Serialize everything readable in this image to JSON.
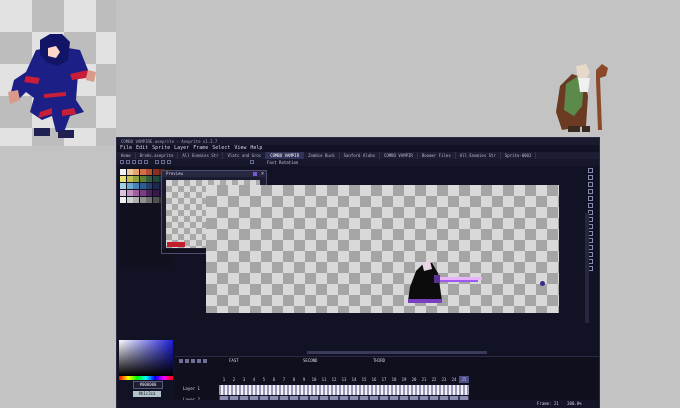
{
  "window": {
    "title": "COMBO VAMPIRE.aseprite - Aseprite v1.2.7"
  },
  "menu": [
    "File",
    "Edit",
    "Sprite",
    "Layer",
    "Frame",
    "Select",
    "View",
    "Help"
  ],
  "tabs": [
    {
      "label": "Home",
      "active": false
    },
    {
      "label": "BroAs.aseprite",
      "active": false
    },
    {
      "label": "All Enemies Str",
      "active": false
    },
    {
      "label": "Vlatc and Groc",
      "active": false
    },
    {
      "label": "COMBO VAMPIR",
      "active": true
    },
    {
      "label": "Zombie Buck",
      "active": false
    },
    {
      "label": "Sanford Alaho",
      "active": false
    },
    {
      "label": "COMBO VAMPIR",
      "active": false
    },
    {
      "label": "Boomer Files",
      "active": false
    },
    {
      "label": "All Enemies Str",
      "active": false
    },
    {
      "label": "Sprite-0002",
      "active": false
    }
  ],
  "toolbar": {
    "frame_label": "Fast Rotation"
  },
  "preview": {
    "title": "Preview"
  },
  "palette": {
    "colors": [
      "#f2f2f2",
      "#f0c8a0",
      "#e6a36b",
      "#d0704a",
      "#b84c32",
      "#8a3020",
      "#5a2618",
      "#2a1208",
      "#e8e070",
      "#c0c050",
      "#90a040",
      "#608030",
      "#306040",
      "#204838",
      "#183048",
      "#102838",
      "#a0d0e8",
      "#70a8d0",
      "#4a80b8",
      "#2f5c90",
      "#243e6e",
      "#1c2850",
      "#181838",
      "#101020",
      "#e0c0e0",
      "#c090c0",
      "#a060a0",
      "#784080",
      "#502060",
      "#381848",
      "#201030",
      "#000000",
      "#f0f0f0",
      "#d0d0d0",
      "#b0b0b0",
      "#909090",
      "#707070",
      "#505050",
      "#303030",
      "#101010"
    ],
    "primary_label": "#000000",
    "secondary_label": "#b1c3ca",
    "tag_label": "#6a6a6a"
  },
  "timeline": {
    "tags": [
      "FAST",
      "SECOND",
      "THIRD"
    ],
    "layers": [
      "Layer 1",
      "Layer 2"
    ],
    "frames": [
      1,
      2,
      3,
      4,
      5,
      6,
      7,
      8,
      9,
      10,
      11,
      12,
      13,
      14,
      15,
      16,
      17,
      18,
      19,
      20,
      21,
      22,
      23,
      24,
      25
    ],
    "current_frame": 25
  },
  "status": {
    "frame_label": "Frame:",
    "frame_value": "21",
    "zoom": "200.0%"
  }
}
